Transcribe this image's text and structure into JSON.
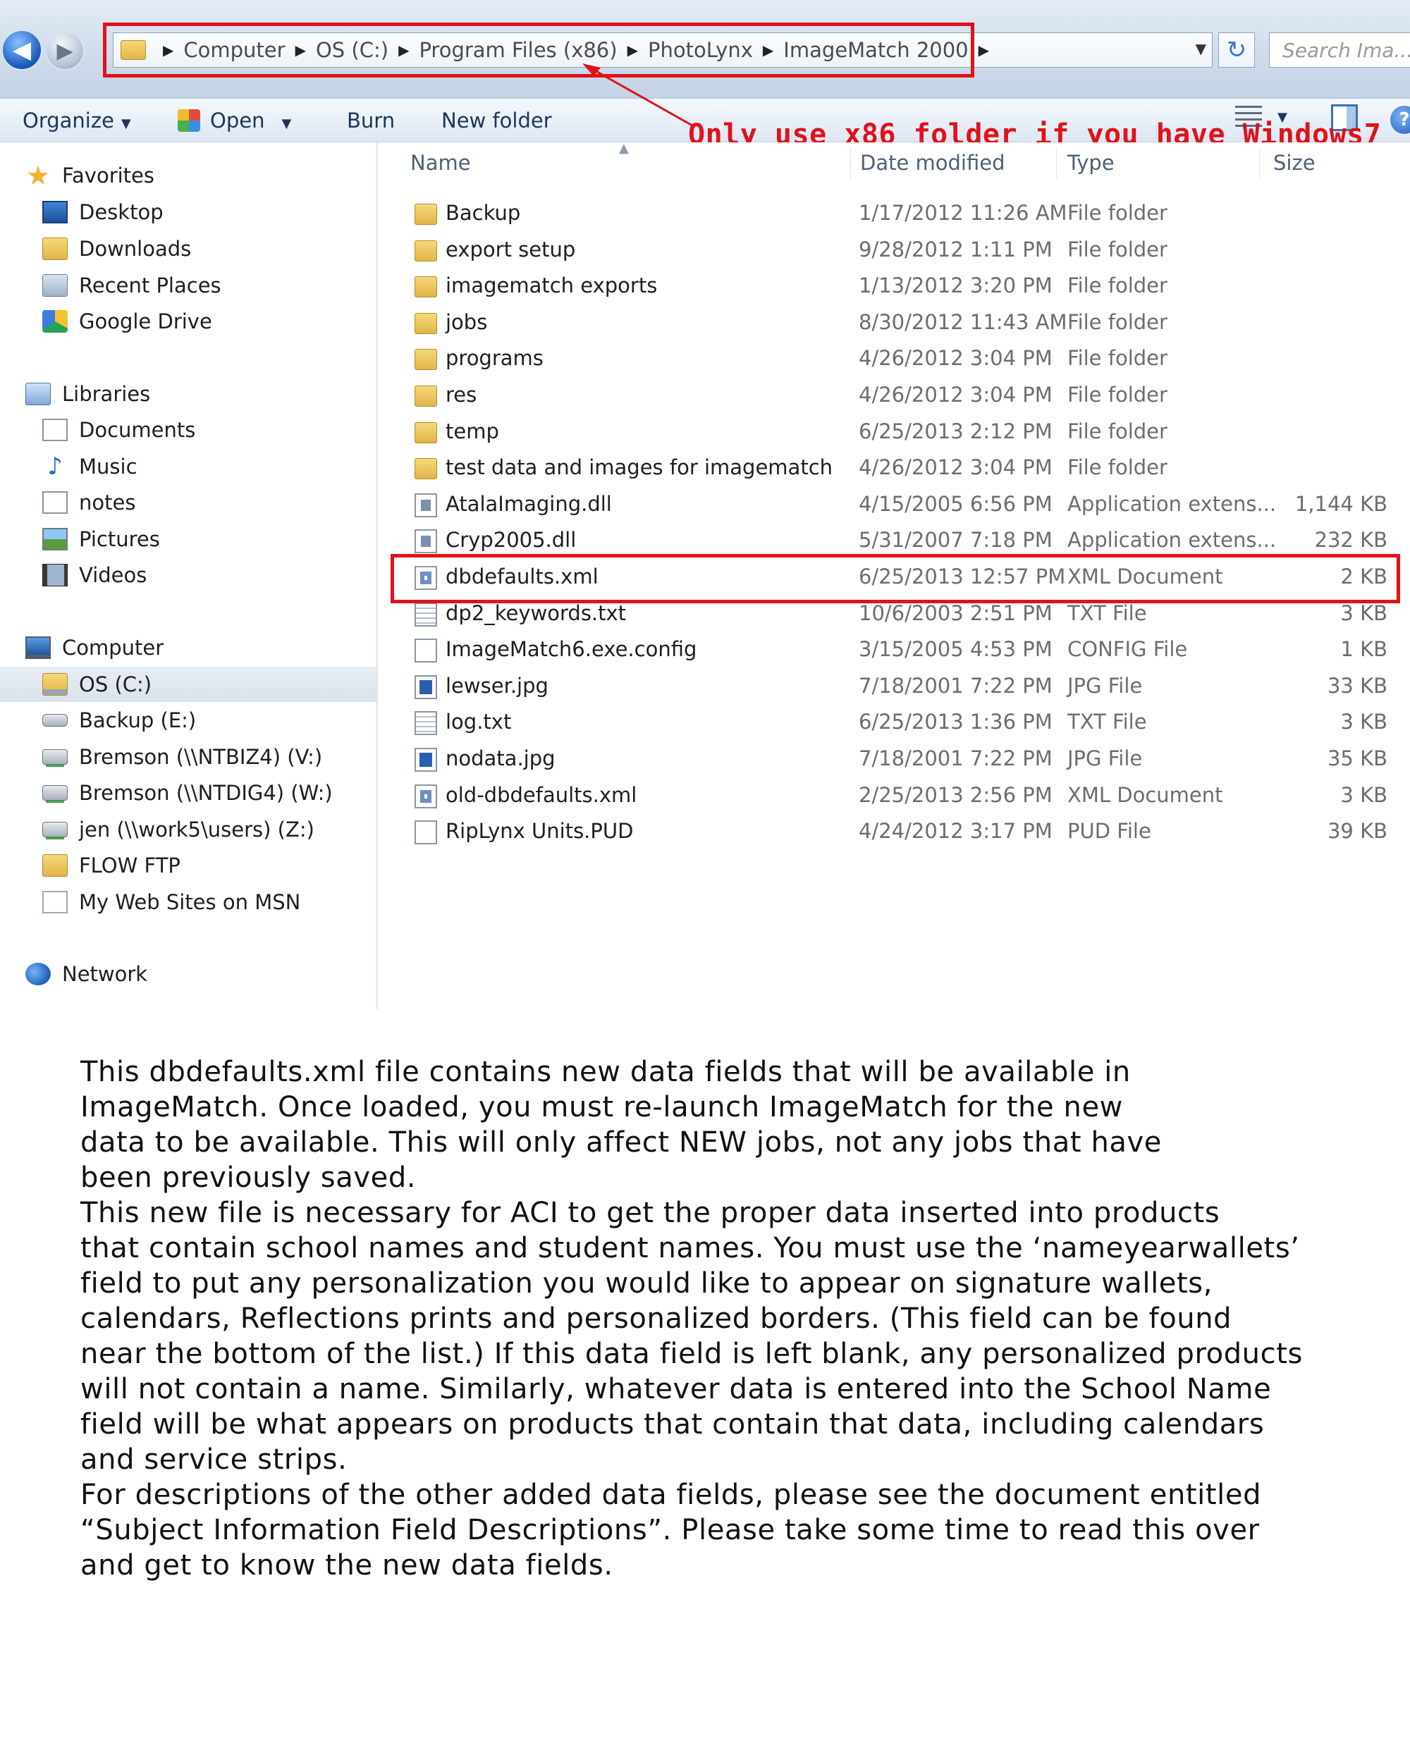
{
  "address_bar": {
    "breadcrumbs": [
      "Computer",
      "OS (C:)",
      "Program Files (x86)",
      "PhotoLynx",
      "ImageMatch 2000"
    ],
    "search_placeholder": "Search Ima...",
    "back_glyph": "◀",
    "forward_glyph": "▶",
    "refresh_glyph": "↻",
    "dropdown_glyph": "▼",
    "separator_glyph": "▶"
  },
  "toolbar": {
    "organize_label": "Organize",
    "open_label": "Open",
    "burn_label": "Burn",
    "new_folder_label": "New folder",
    "caret_glyph": "▼",
    "help_glyph": "?"
  },
  "annotation": {
    "text": "Only use x86 folder if you have Windows7",
    "color": "#e0121b"
  },
  "navigation": {
    "favorites": {
      "label": "Favorites",
      "items": [
        {
          "label": "Desktop",
          "icon": "desktop-icon"
        },
        {
          "label": "Downloads",
          "icon": "downloads-folder-icon"
        },
        {
          "label": "Recent Places",
          "icon": "recent-places-icon"
        },
        {
          "label": "Google Drive",
          "icon": "google-drive-icon"
        }
      ]
    },
    "libraries": {
      "label": "Libraries",
      "items": [
        {
          "label": "Documents",
          "icon": "documents-icon"
        },
        {
          "label": "Music",
          "icon": "music-icon"
        },
        {
          "label": "notes",
          "icon": "document-icon"
        },
        {
          "label": "Pictures",
          "icon": "pictures-icon"
        },
        {
          "label": "Videos",
          "icon": "videos-icon"
        }
      ]
    },
    "computer": {
      "label": "Computer",
      "items": [
        {
          "label": "OS (C:)",
          "icon": "os-drive-icon",
          "selected": true
        },
        {
          "label": "Backup (E:)",
          "icon": "drive-icon"
        },
        {
          "label": "Bremson (\\\\NTBIZ4) (V:)",
          "icon": "network-drive-icon"
        },
        {
          "label": "Bremson (\\\\NTDIG4) (W:)",
          "icon": "network-drive-icon"
        },
        {
          "label": "jen (\\\\work5\\users) (Z:)",
          "icon": "network-drive-icon"
        },
        {
          "label": "FLOW FTP",
          "icon": "folder-icon"
        },
        {
          "label": "My Web Sites on MSN",
          "icon": "blank-document-icon"
        }
      ]
    },
    "network": {
      "label": "Network"
    }
  },
  "file_list": {
    "columns": {
      "name": "Name",
      "date": "Date modified",
      "type": "Type",
      "size": "Size"
    },
    "sort_glyph": "▲",
    "rows": [
      {
        "name": "Backup",
        "date": "1/17/2012 11:26 AM",
        "type": "File folder",
        "size": "",
        "icon": "folder"
      },
      {
        "name": "export setup",
        "date": "9/28/2012 1:11 PM",
        "type": "File folder",
        "size": "",
        "icon": "folder"
      },
      {
        "name": "imagematch exports",
        "date": "1/13/2012 3:20 PM",
        "type": "File folder",
        "size": "",
        "icon": "folder"
      },
      {
        "name": "jobs",
        "date": "8/30/2012 11:43 AM",
        "type": "File folder",
        "size": "",
        "icon": "folder"
      },
      {
        "name": "programs",
        "date": "4/26/2012 3:04 PM",
        "type": "File folder",
        "size": "",
        "icon": "folder"
      },
      {
        "name": "res",
        "date": "4/26/2012 3:04 PM",
        "type": "File folder",
        "size": "",
        "icon": "folder"
      },
      {
        "name": "temp",
        "date": "6/25/2013 2:12 PM",
        "type": "File folder",
        "size": "",
        "icon": "folder"
      },
      {
        "name": "test data and images for imagematch",
        "date": "4/26/2012 3:04 PM",
        "type": "File folder",
        "size": "",
        "icon": "folder"
      },
      {
        "name": "AtalaImaging.dll",
        "date": "4/15/2005 6:56 PM",
        "type": "Application extens...",
        "size": "1,144 KB",
        "icon": "dll"
      },
      {
        "name": "Cryp2005.dll",
        "date": "5/31/2007 7:18 PM",
        "type": "Application extens...",
        "size": "232 KB",
        "icon": "dll"
      },
      {
        "name": "dbdefaults.xml",
        "date": "6/25/2013 12:57 PM",
        "type": "XML Document",
        "size": "2 KB",
        "icon": "xml",
        "highlighted": true
      },
      {
        "name": "dp2_keywords.txt",
        "date": "10/6/2003 2:51 PM",
        "type": "TXT File",
        "size": "3 KB",
        "icon": "txt"
      },
      {
        "name": "ImageMatch6.exe.config",
        "date": "3/15/2005 4:53 PM",
        "type": "CONFIG File",
        "size": "1 KB",
        "icon": "blank"
      },
      {
        "name": "lewser.jpg",
        "date": "7/18/2001 7:22 PM",
        "type": "JPG File",
        "size": "33 KB",
        "icon": "jpg"
      },
      {
        "name": "log.txt",
        "date": "6/25/2013 1:36 PM",
        "type": "TXT File",
        "size": "3 KB",
        "icon": "txt"
      },
      {
        "name": "nodata.jpg",
        "date": "7/18/2001 7:22 PM",
        "type": "JPG File",
        "size": "35 KB",
        "icon": "jpg"
      },
      {
        "name": "old-dbdefaults.xml",
        "date": "2/25/2013 2:56 PM",
        "type": "XML Document",
        "size": "3 KB",
        "icon": "xml"
      },
      {
        "name": "RipLynx Units.PUD",
        "date": "4/24/2012 3:17 PM",
        "type": "PUD File",
        "size": "39 KB",
        "icon": "blank"
      }
    ]
  },
  "explanation": {
    "paragraphs": [
      "This dbdefaults.xml file contains new data fields that will be available in\nImageMatch.  Once loaded, you must re-launch ImageMatch for the new\ndata to be available.  This will only affect NEW jobs, not any jobs that have\nbeen previously saved.",
      "This new file is necessary for ACI to get the proper data inserted into products\nthat contain school names and student names.  You must use the ‘nameyearwallets’\nfield to put any personalization you would like to appear on signature wallets,\ncalendars, Reflections prints and personalized borders.  (This field can be found\nnear the bottom of the list.)  If this data field is left blank, any personalized products\nwill not contain a name.  Similarly, whatever data is entered into the School Name\nfield will be what appears on products that contain that data, including calendars\nand service strips.",
      "For descriptions of the other added data fields, please see the document entitled\n“Subject Information Field Descriptions”.  Please take some time to read this over\nand get to know the new data fields."
    ]
  }
}
